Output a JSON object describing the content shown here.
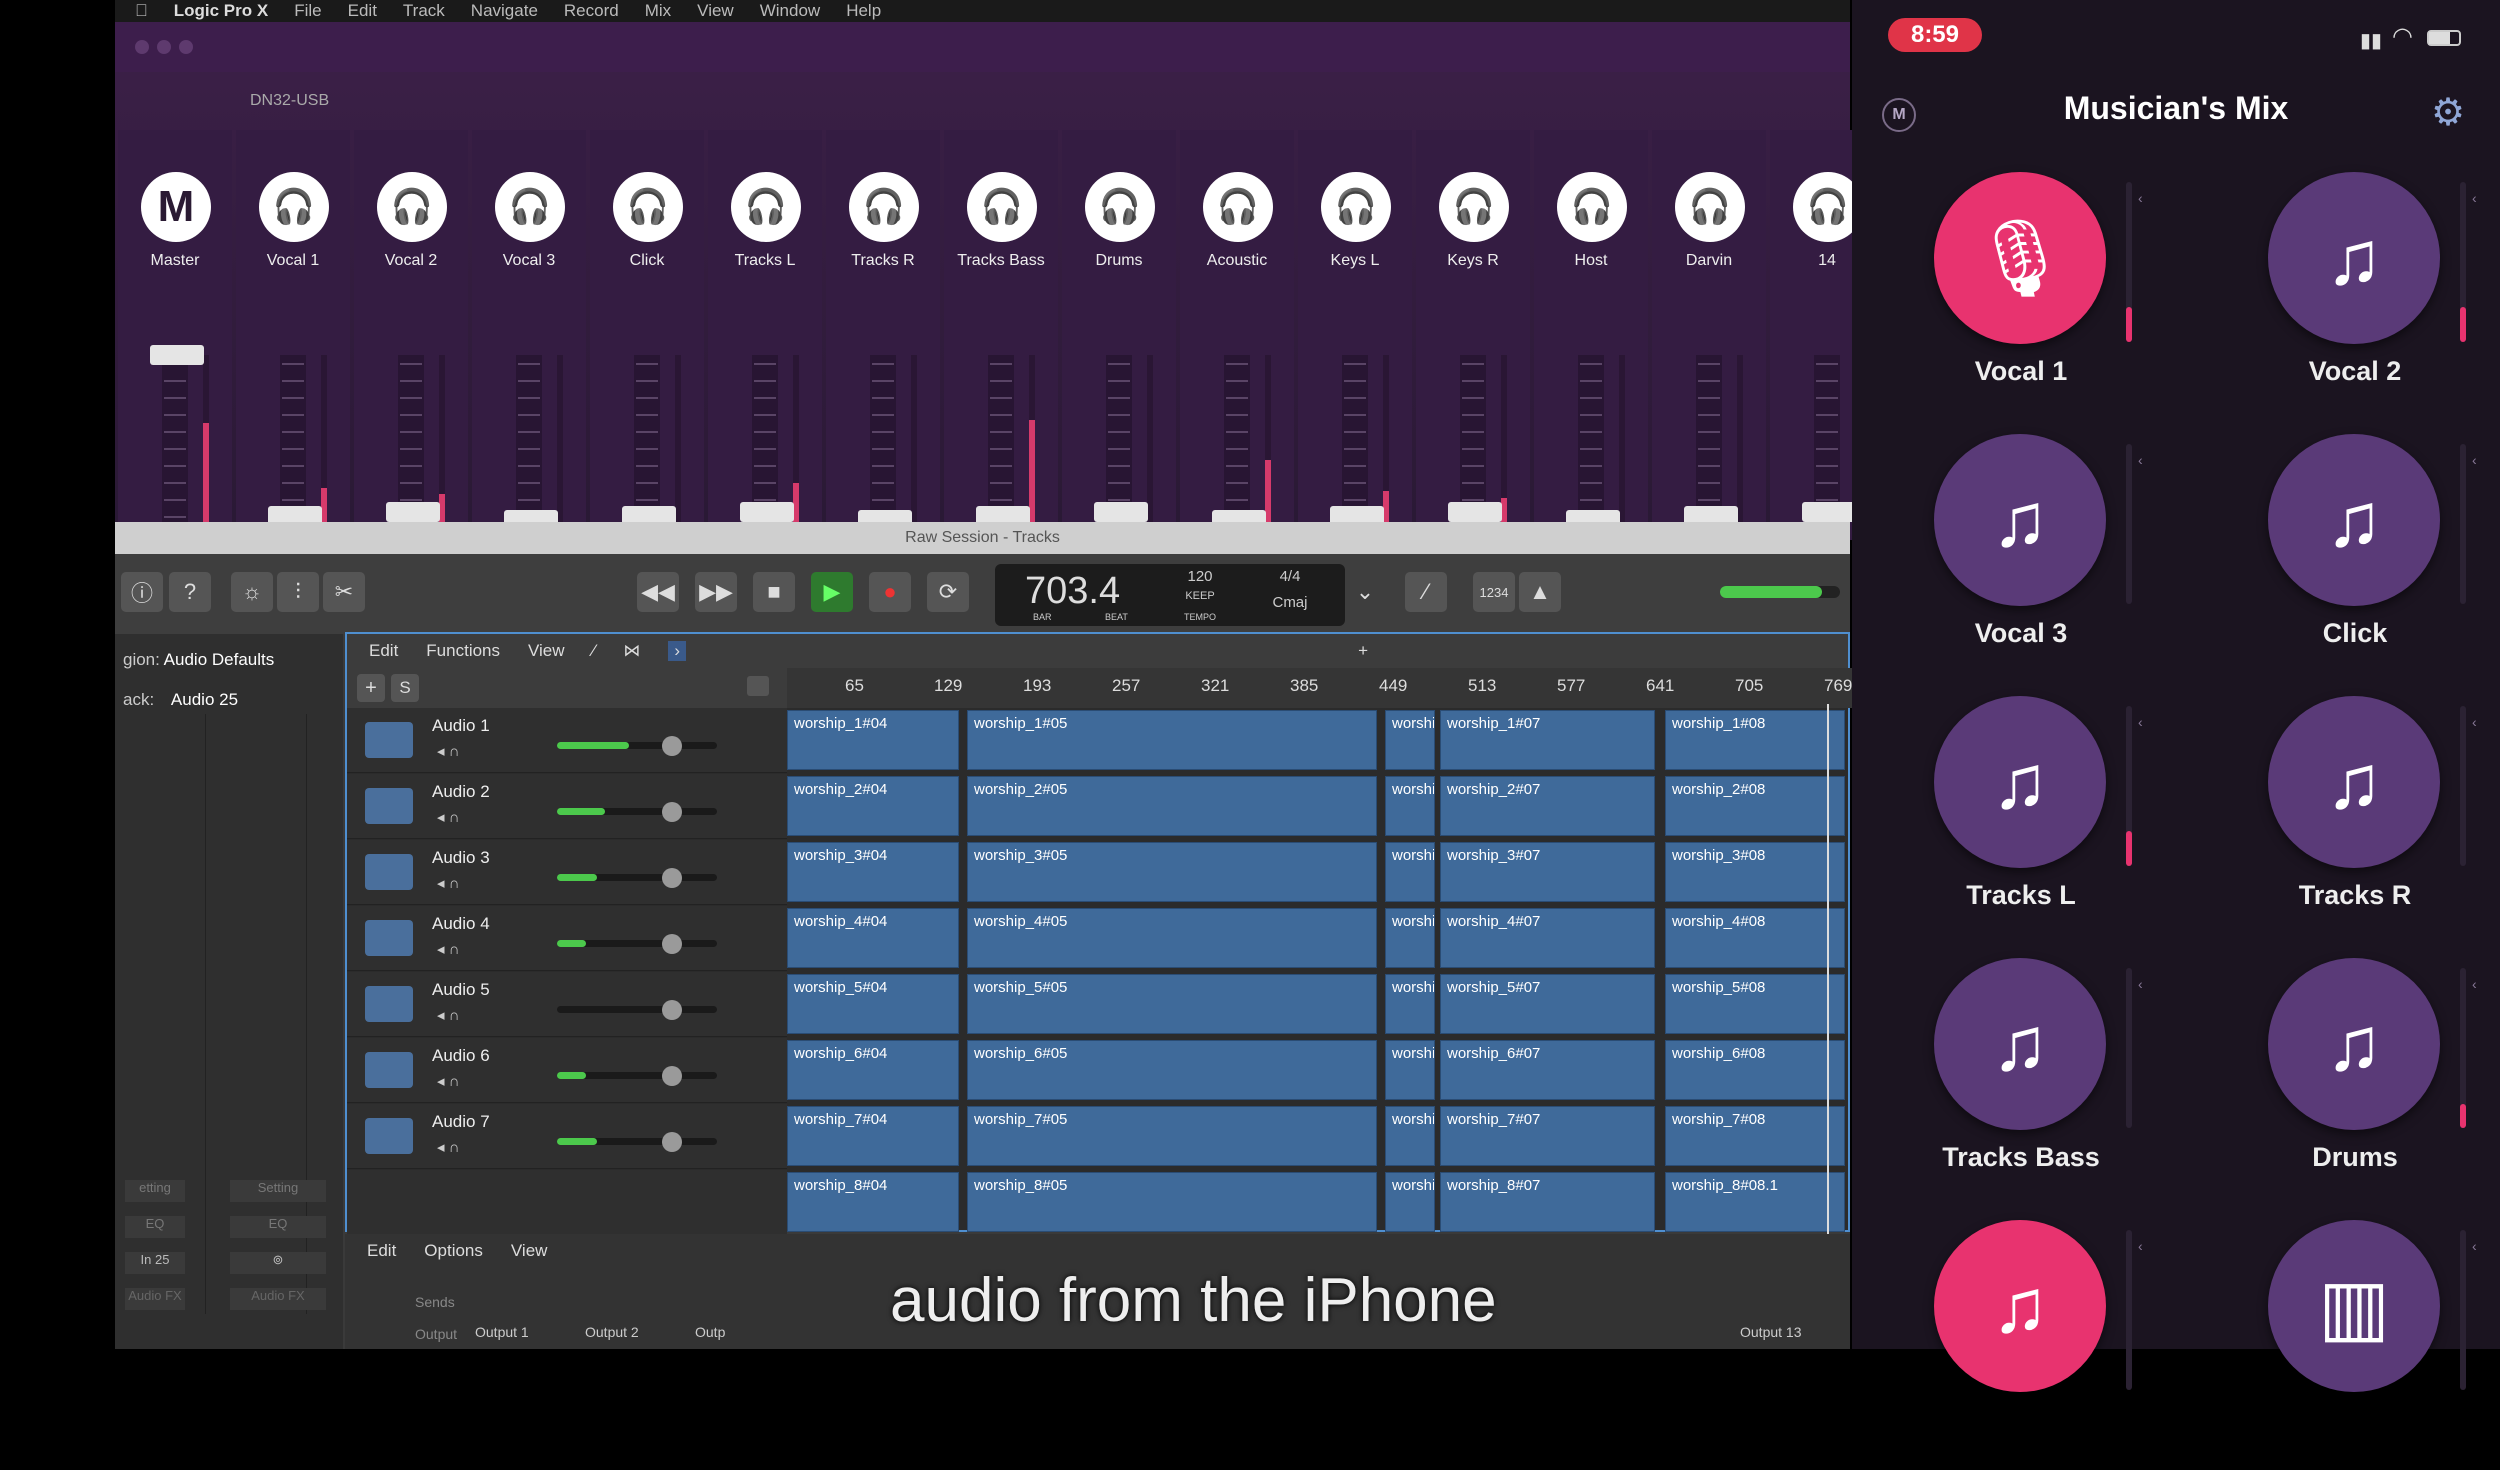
{
  "menubar": {
    "apple_icon": "apple-icon",
    "app": "Logic Pro X",
    "items": [
      "File",
      "Edit",
      "Track",
      "Navigate",
      "Record",
      "Mix",
      "View",
      "Window",
      "Help"
    ]
  },
  "mixer": {
    "device": "DN32-USB",
    "strips": [
      {
        "label": "Master",
        "icon": "M",
        "meter": 0.6
      },
      {
        "label": "Vocal 1",
        "icon": "headphones-icon",
        "meter": 0.22
      },
      {
        "label": "Vocal 2",
        "icon": "headphones-icon",
        "meter": 0.18
      },
      {
        "label": "Vocal 3",
        "icon": "headphones-icon",
        "meter": 0.0
      },
      {
        "label": "Click",
        "icon": "headphones-icon",
        "meter": 0.0
      },
      {
        "label": "Tracks L",
        "icon": "headphones-icon",
        "meter": 0.25
      },
      {
        "label": "Tracks R",
        "icon": "headphones-icon",
        "meter": 0.0
      },
      {
        "label": "Tracks Bass",
        "icon": "headphones-icon",
        "meter": 0.62
      },
      {
        "label": "Drums",
        "icon": "headphones-icon",
        "meter": 0.0
      },
      {
        "label": "Acoustic",
        "icon": "headphones-icon",
        "meter": 0.38
      },
      {
        "label": "Keys L",
        "icon": "headphones-icon",
        "meter": 0.2
      },
      {
        "label": "Keys R",
        "icon": "headphones-icon",
        "meter": 0.16
      },
      {
        "label": "Host",
        "icon": "headphones-icon",
        "meter": 0.0
      },
      {
        "label": "Darvin",
        "icon": "headphones-icon",
        "meter": 0.0
      },
      {
        "label": "14",
        "icon": "headphones-icon",
        "meter": 0.0
      }
    ]
  },
  "logic": {
    "window_title": "Raw Session - Tracks",
    "transport": {
      "position": "703.4",
      "position_sub_a": "BAR",
      "position_sub_b": "BEAT",
      "tempo": "120",
      "tempo_keep": "KEEP",
      "tempo_label": "TEMPO",
      "signature": "4/4",
      "key": "Cmaj",
      "count_in": "1234"
    },
    "inspector": {
      "region_label": "gion:",
      "region_value": "Audio Defaults",
      "track_label": "ack:",
      "track_value": "Audio 25",
      "bottom": [
        "etting",
        "Setting",
        "EQ",
        "EQ",
        "In 25",
        "Audio FX",
        "Audio FX"
      ]
    },
    "tracks_toolbar": {
      "edit": "Edit",
      "functions": "Functions",
      "view": "View"
    },
    "ruler": [
      "65",
      "129",
      "193",
      "257",
      "321",
      "385",
      "449",
      "513",
      "577",
      "641",
      "705",
      "769"
    ],
    "track_add": "+",
    "track_s": "S",
    "tracks": [
      {
        "name": "Audio 1",
        "volume": 0.45,
        "regions": [
          "worship_1#04",
          "worship_1#05",
          "worshi",
          "worship_1#07",
          "worship_1#08"
        ]
      },
      {
        "name": "Audio 2",
        "volume": 0.3,
        "regions": [
          "worship_2#04",
          "worship_2#05",
          "worshi",
          "worship_2#07",
          "worship_2#08"
        ]
      },
      {
        "name": "Audio 3",
        "volume": 0.25,
        "regions": [
          "worship_3#04",
          "worship_3#05",
          "worshi",
          "worship_3#07",
          "worship_3#08"
        ]
      },
      {
        "name": "Audio 4",
        "volume": 0.18,
        "regions": [
          "worship_4#04",
          "worship_4#05",
          "worshi",
          "worship_4#07",
          "worship_4#08"
        ]
      },
      {
        "name": "Audio 5",
        "volume": 0.0,
        "regions": [
          "worship_5#04",
          "worship_5#05",
          "worshi",
          "worship_5#07",
          "worship_5#08"
        ]
      },
      {
        "name": "Audio 6",
        "volume": 0.18,
        "regions": [
          "worship_6#04",
          "worship_6#05",
          "worshi",
          "worship_6#07",
          "worship_6#08"
        ]
      },
      {
        "name": "Audio 7",
        "volume": 0.25,
        "regions": [
          "worship_7#04",
          "worship_7#05",
          "worshi",
          "worship_7#07",
          "worship_7#08"
        ]
      },
      {
        "name": "",
        "volume": 0.0,
        "regions": [
          "worship_8#04",
          "worship_8#05",
          "worshi",
          "worship_8#07",
          "worship_8#08.1"
        ]
      }
    ],
    "bottom_toolbar": {
      "edit": "Edit",
      "options": "Options",
      "view": "View"
    },
    "sends_label": "Sends",
    "output_label": "Output",
    "outputs": [
      "Output 1",
      "Output 2",
      "Outp",
      "Output 13"
    ]
  },
  "subtitle": "audio from the iPhone",
  "phone": {
    "time": "8:59",
    "app_title": "Musician's Mix",
    "badge": "M",
    "channels": [
      {
        "label": "Vocal 1",
        "icon": "microphone-icon",
        "active": true,
        "level": 0.22
      },
      {
        "label": "Vocal 2",
        "icon": "music-note-icon",
        "active": false,
        "level": 0.22
      },
      {
        "label": "Vocal 3",
        "icon": "music-note-icon",
        "active": false,
        "level": 0.0
      },
      {
        "label": "Click",
        "icon": "music-note-icon",
        "active": false,
        "level": 0.0
      },
      {
        "label": "Tracks L",
        "icon": "music-note-icon",
        "active": false,
        "level": 0.22
      },
      {
        "label": "Tracks R",
        "icon": "music-note-icon",
        "active": false,
        "level": 0.0
      },
      {
        "label": "Tracks Bass",
        "icon": "music-note-icon",
        "active": false,
        "level": 0.0
      },
      {
        "label": "Drums",
        "icon": "music-note-icon",
        "active": false,
        "level": 0.15
      },
      {
        "label": "",
        "icon": "music-note-icon",
        "active": true,
        "level": 0.0
      },
      {
        "label": "",
        "icon": "piano-icon",
        "active": false,
        "level": 0.0
      }
    ]
  },
  "colors": {
    "accent": "#e8336f",
    "purple": "#5a3a78",
    "region": "#3f6a9a"
  }
}
